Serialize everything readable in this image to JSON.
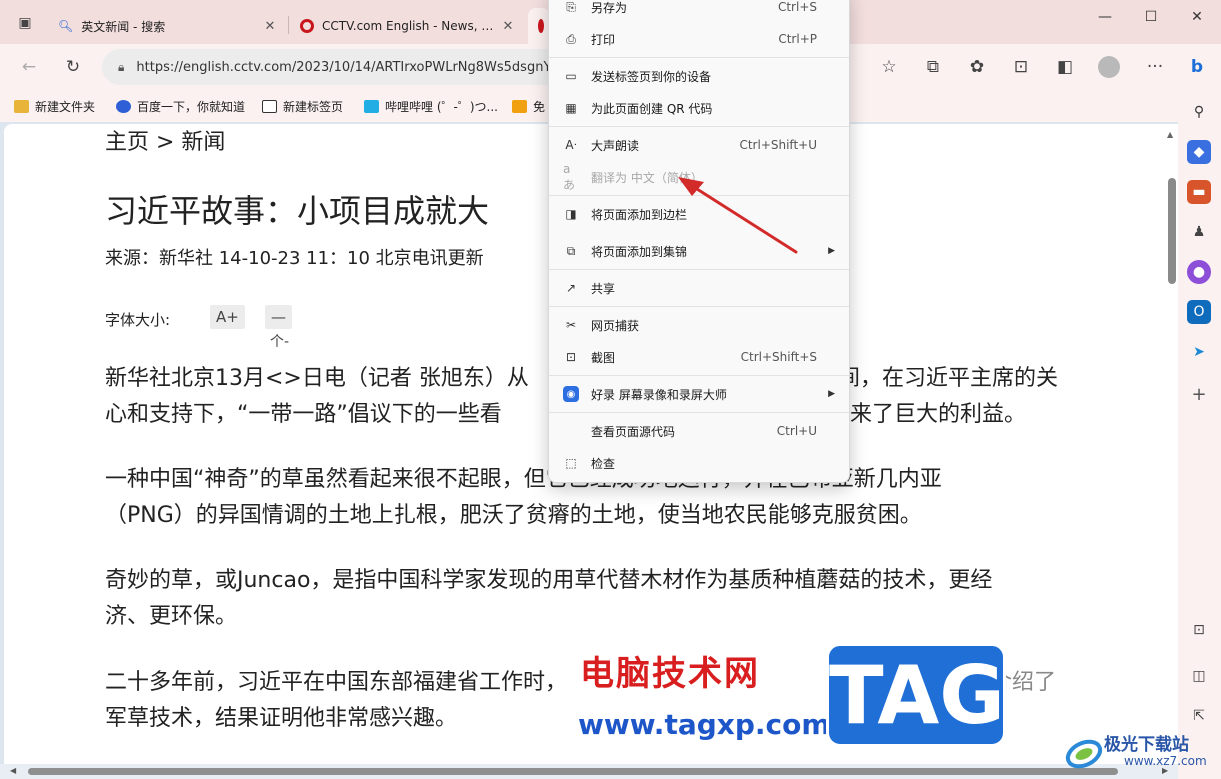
{
  "tabs": [
    {
      "title": "英文新闻 - 搜索",
      "icon": "search-icon"
    },
    {
      "title": "CCTV.com English - News, Video",
      "icon": "cctv-logo-icon"
    },
    {
      "title": "",
      "icon": "cctv-logo-icon"
    }
  ],
  "address_bar": {
    "url": "https://english.cctv.com/2023/10/14/ARTIrxoPWLrNg8Ws5dsgnY"
  },
  "bookmarks": [
    {
      "label": "新建文件夹",
      "icon": "folder-icon"
    },
    {
      "label": "百度一下，你就知道",
      "icon": "baidu-icon"
    },
    {
      "label": "新建标签页",
      "icon": "new-tab-icon"
    },
    {
      "label": "哔哩哔哩 (゜-゜)つ...",
      "icon": "bilibili-icon"
    },
    {
      "label": "免",
      "icon": "play-icon"
    }
  ],
  "article": {
    "breadcrumb": "主页 > 新闻",
    "headline": "习近平故事：小项目成就大",
    "source": "来源：新华社 14-10-23 11：10 北京电讯更新",
    "font_size_label": "字体大小:",
    "font_increase": "A+",
    "font_decrease": "—",
    "font_decrease_sub": "个-",
    "paragraphs": [
      {
        "line1": "新华社北京13月<>日电（记者 张旭东）从",
        "line1_tail": "间，在习近平主席的关",
        "line2": "心和支持下，“一带一路”倡议下的一些看",
        "line2_tail": "来了巨大的利益。"
      },
      {
        "line1": "一种中国“神奇”的草虽然看起来很不起眼，但它已经成功地运行，并在巴布亚新几内亚",
        "line2": "（PNG）的异国情调的土地上扎根，肥沃了贫瘠的土地，使当地农民能够克服贫困。"
      },
      {
        "line1": "奇妙的草，或Juncao，是指中国科学家发现的用草代替木材作为基质种植蘑菇的技术，更经",
        "line2": "济、更环保。"
      },
      {
        "line1": "二十多年前，习近平在中国东部福建省工作时，",
        "line1_tail": "向来访省长介绍了",
        "line2": "军草技术，结果证明他非常感兴趣。"
      }
    ]
  },
  "context_menu": {
    "items": [
      {
        "label": "另存为",
        "shortcut": "Ctrl+S",
        "icon": "save-as-icon"
      },
      {
        "label": "打印",
        "shortcut": "Ctrl+P",
        "icon": "print-icon"
      },
      {
        "label": "发送标签页到你的设备",
        "shortcut": "",
        "icon": "send-to-device-icon"
      },
      {
        "label": "为此页面创建 QR 代码",
        "shortcut": "",
        "icon": "qr-code-icon"
      },
      {
        "label": "大声朗读",
        "shortcut": "Ctrl+Shift+U",
        "icon": "read-aloud-icon"
      },
      {
        "label": "翻译为 中文（简体）",
        "shortcut": "",
        "icon": "translate-icon",
        "disabled": true
      },
      {
        "label": "将页面添加到边栏",
        "shortcut": "",
        "icon": "add-to-sidebar-icon"
      },
      {
        "label": "将页面添加到集锦",
        "shortcut": "",
        "icon": "collections-icon",
        "submenu": true
      },
      {
        "label": "共享",
        "shortcut": "",
        "icon": "share-icon"
      },
      {
        "label": "网页捕获",
        "shortcut": "",
        "icon": "web-capture-icon"
      },
      {
        "label": "截图",
        "shortcut": "Ctrl+Shift+S",
        "icon": "screenshot-icon"
      },
      {
        "label": "好录 屏幕录像和录屏大师",
        "shortcut": "",
        "icon": "recorder-icon",
        "submenu": true
      },
      {
        "label": "查看页面源代码",
        "shortcut": "Ctrl+U",
        "icon": ""
      },
      {
        "label": "检查",
        "shortcut": "",
        "icon": "inspect-icon"
      }
    ]
  },
  "watermarks": {
    "site_name": "电脑技术网",
    "site_url": "www.tagxp.com",
    "tag_logo": "TAG",
    "jiguang_name": "极光下载站",
    "jiguang_url": "www.xz7.com"
  },
  "colors": {
    "accent_red_arrow": "#d32a2a",
    "watermark_red": "#d81e1e",
    "watermark_blue": "#1d56c8",
    "tag_blue": "#1f6fd6"
  }
}
